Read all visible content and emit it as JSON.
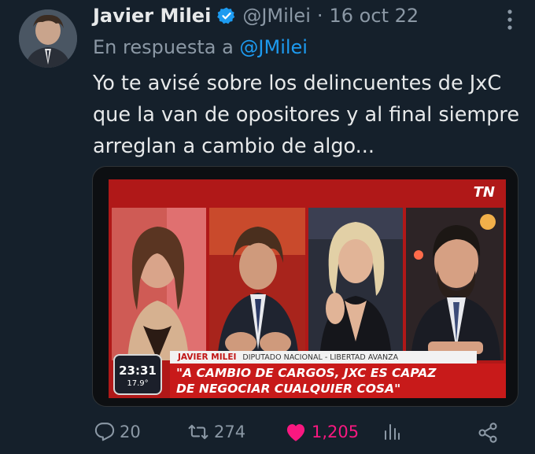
{
  "tweet": {
    "author_name": "Javier Milei",
    "handle": "@JMilei",
    "separator": "·",
    "date": "16 oct 22",
    "reply_prefix": "En respuesta a",
    "reply_to": "@JMilei",
    "text": "Yo te avisé sobre los delincuentes de JxC que la van de opositores y al final siempre arreglan a cambio de algo..."
  },
  "media": {
    "channel_logo": "TN",
    "lower_third_name": "JAVIER MILEI",
    "lower_third_role": "DIPUTADO NACIONAL - LIBERTAD AVANZA",
    "headline_line1": "\"A CAMBIO DE CARGOS, JXC ES CAPAZ",
    "headline_line2": "DE NEGOCIAR CUALQUIER COSA\"",
    "clock_time": "23:31",
    "clock_temp": "17.9°"
  },
  "actions": {
    "replies": "20",
    "retweets": "274",
    "likes": "1,205"
  },
  "icons": {
    "verified": "verified-badge-icon",
    "more": "more-options-icon",
    "reply": "reply-icon",
    "retweet": "retweet-icon",
    "like": "heart-icon",
    "views": "analytics-icon",
    "share": "share-icon"
  },
  "colors": {
    "background": "#15202b",
    "accent": "#1d9bf0",
    "like": "#f91880",
    "muted": "#8b98a5",
    "tv_red": "#c81a1a"
  }
}
